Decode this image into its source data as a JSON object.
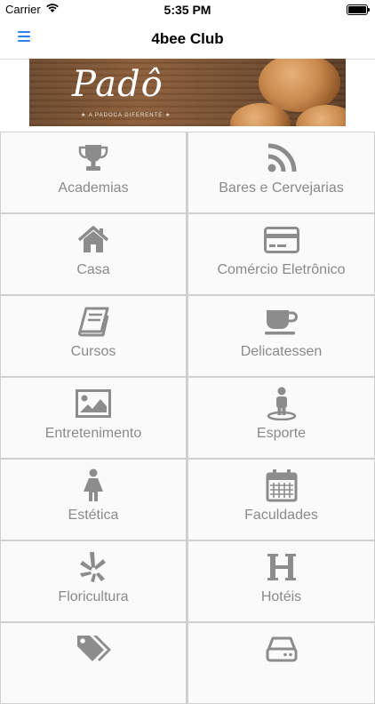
{
  "status_bar": {
    "carrier": "Carrier",
    "time": "5:35 PM"
  },
  "nav": {
    "title": "4bee Club",
    "menu_icon": "hamburger-menu-icon"
  },
  "banner": {
    "brand": "Padô",
    "tagline": "★ A PADOCA DIFERENTE ★"
  },
  "colors": {
    "accent": "#2f80ed",
    "icon": "#8c8c8c",
    "label": "#8a8a8a"
  },
  "categories": [
    {
      "label": "Academias",
      "icon": "trophy-icon"
    },
    {
      "label": "Bares e Cervejarias",
      "icon": "rss-icon"
    },
    {
      "label": "Casa",
      "icon": "home-icon"
    },
    {
      "label": "Comércio Eletrônico",
      "icon": "credit-card-icon"
    },
    {
      "label": "Cursos",
      "icon": "book-icon"
    },
    {
      "label": "Delicatessen",
      "icon": "coffee-cup-icon"
    },
    {
      "label": "Entretenimento",
      "icon": "image-icon"
    },
    {
      "label": "Esporte",
      "icon": "person-pin-icon"
    },
    {
      "label": "Estética",
      "icon": "female-icon"
    },
    {
      "label": "Faculdades",
      "icon": "calendar-icon"
    },
    {
      "label": "Floricultura",
      "icon": "yelp-icon"
    },
    {
      "label": "Hotéis",
      "icon": "hotel-h-icon"
    },
    {
      "label": "",
      "icon": "tags-icon"
    },
    {
      "label": "",
      "icon": "hdd-icon"
    }
  ]
}
